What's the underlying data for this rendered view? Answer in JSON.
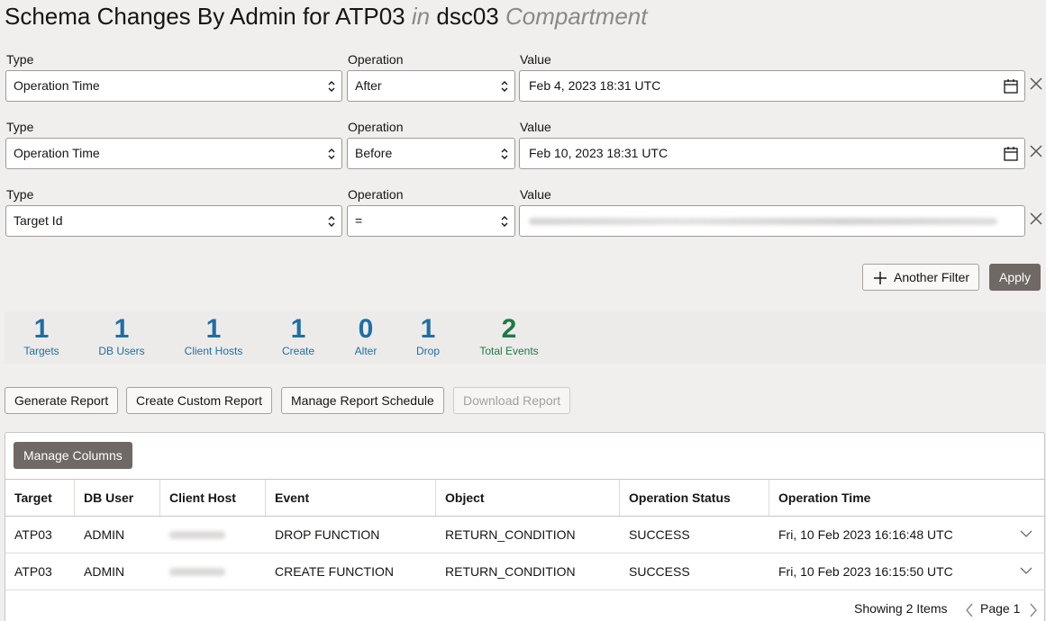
{
  "header": {
    "title_main": "Schema Changes By Admin for ATP03",
    "title_in": "in",
    "title_compartment": "dsc03",
    "title_suffix": "Compartment"
  },
  "filters": {
    "type_label": "Type",
    "operation_label": "Operation",
    "value_label": "Value",
    "rows": [
      {
        "type": "Operation Time",
        "operation": "After",
        "value": "Feb 4, 2023 18:31 UTC"
      },
      {
        "type": "Operation Time",
        "operation": "Before",
        "value": "Feb 10, 2023 18:31 UTC"
      },
      {
        "type": "Target Id",
        "operation": "=",
        "value": ""
      }
    ],
    "another_filter_label": "Another Filter",
    "apply_label": "Apply"
  },
  "stats": [
    {
      "value": "1",
      "label": "Targets"
    },
    {
      "value": "1",
      "label": "DB Users"
    },
    {
      "value": "1",
      "label": "Client Hosts"
    },
    {
      "value": "1",
      "label": "Create"
    },
    {
      "value": "0",
      "label": "Alter"
    },
    {
      "value": "1",
      "label": "Drop"
    },
    {
      "value": "2",
      "label": "Total Events"
    }
  ],
  "report_actions": {
    "generate": "Generate Report",
    "create_custom": "Create Custom Report",
    "manage_schedule": "Manage Report Schedule",
    "download": "Download Report"
  },
  "table": {
    "manage_columns_label": "Manage Columns",
    "columns": [
      "Target",
      "DB User",
      "Client Host",
      "Event",
      "Object",
      "Operation Status",
      "Operation Time"
    ],
    "rows": [
      {
        "target": "ATP03",
        "db_user": "ADMIN",
        "event": "DROP FUNCTION",
        "object": "RETURN_CONDITION",
        "status": "SUCCESS",
        "time": "Fri, 10 Feb 2023 16:16:48 UTC"
      },
      {
        "target": "ATP03",
        "db_user": "ADMIN",
        "event": "CREATE FUNCTION",
        "object": "RETURN_CONDITION",
        "status": "SUCCESS",
        "time": "Fri, 10 Feb 2023 16:15:50 UTC"
      }
    ],
    "showing": "Showing 2 Items",
    "page": "Page 1"
  },
  "colors": {
    "stat_blue": "#1d6fa5",
    "stat_green": "#1c7a47",
    "primary_button": "#6f6864"
  }
}
